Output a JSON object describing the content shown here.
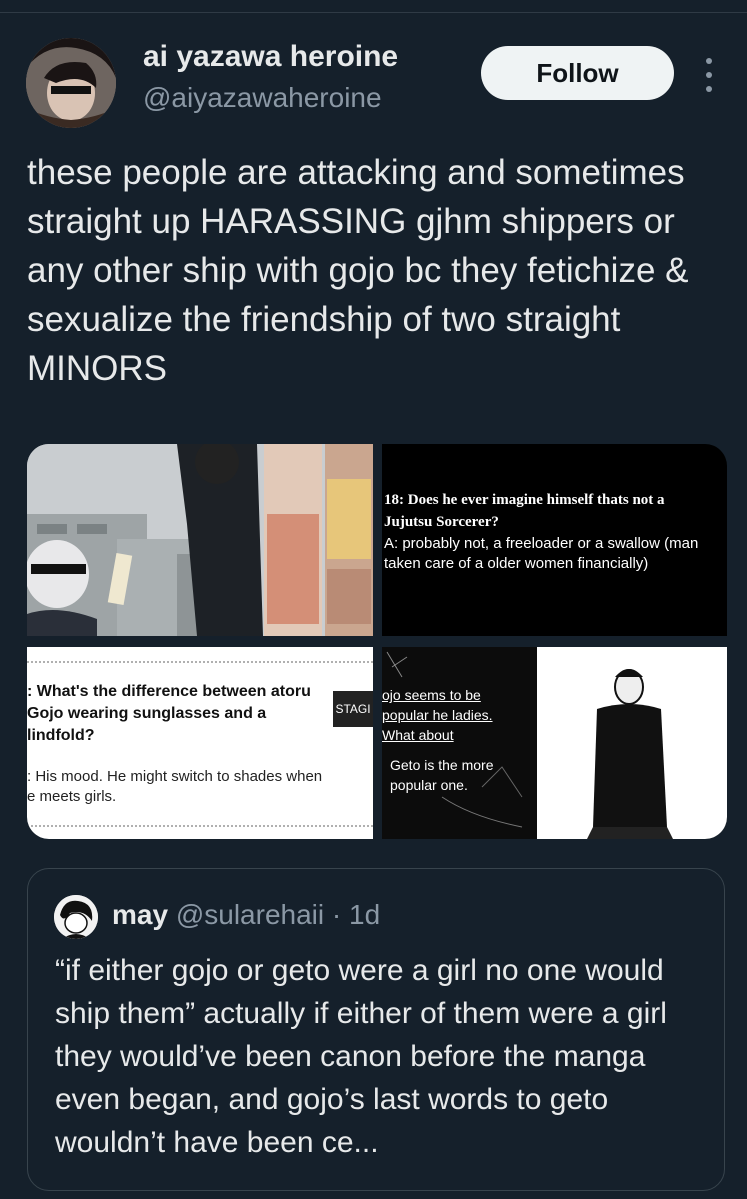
{
  "author": {
    "name": "ai yazawa heroine",
    "handle": "@aiyazawaheroine"
  },
  "follow_label": "Follow",
  "tweet_text": "these people are attacking and sometimes straight up HARASSING gjhm shippers or any other ship with gojo bc they fetichize & sexualize the friendship of two straight MINORS",
  "media": {
    "panel2": {
      "question": "18: Does he ever imagine himself thats not a Jujutsu Sorcerer?",
      "answer": "A: probably not, a freeloader or a swallow (man taken care of a older women financially)"
    },
    "panel3": {
      "question": ": What's the difference between atoru Gojo wearing sunglasses and a lindfold?",
      "answer": ": His mood. He might switch to shades when e meets girls.",
      "tag": "STAGI"
    },
    "panel4": {
      "line1": "ojo seems to be popular he ladies. What about",
      "line2": "Geto is the more popular one."
    }
  },
  "quoted": {
    "name": "may",
    "handle": "@sularehaii",
    "separator": "·",
    "time": "1d",
    "text": "“if either gojo or geto were a girl no one would ship them” actually if either of them were a girl they would’ve been canon before the manga even began, and gojo’s last words to geto wouldn’t have been ce..."
  },
  "colors": {
    "background": "#15202b",
    "text": "#e7e9ea",
    "secondary": "#8b98a5",
    "follow_bg": "#eff3f4",
    "border": "#38444d"
  },
  "icons": [
    "more-options-icon"
  ]
}
